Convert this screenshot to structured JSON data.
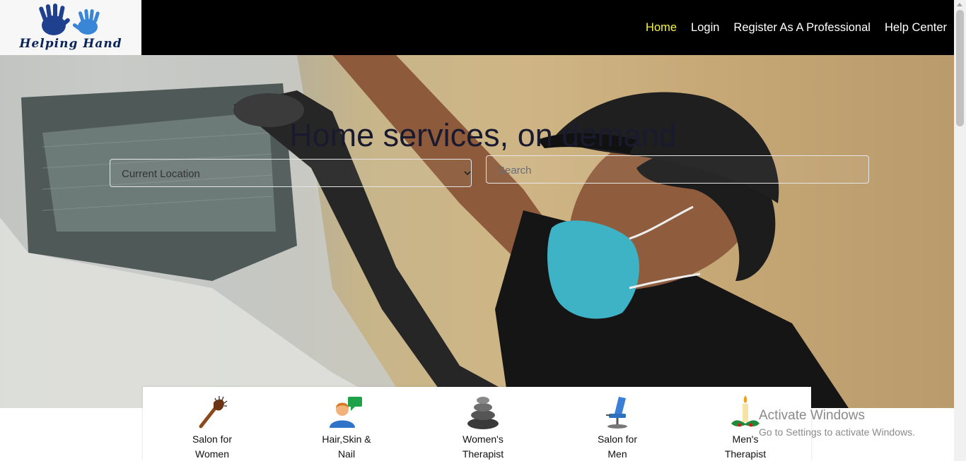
{
  "brand": {
    "name": "Helping Hand"
  },
  "nav": {
    "items": [
      {
        "label": "Home",
        "active": true
      },
      {
        "label": "Login"
      },
      {
        "label": "Register As A Professional"
      },
      {
        "label": "Help Center"
      }
    ]
  },
  "hero": {
    "title": "Home services, on demand",
    "location_select": {
      "selected": "Current Location"
    },
    "search": {
      "placeholder": "Search"
    }
  },
  "categories": [
    {
      "line1": "Salon for",
      "line2": "Women",
      "icon": "comb-icon"
    },
    {
      "line1": "Hair,Skin &",
      "line2": "Nail",
      "icon": "person-chat-icon"
    },
    {
      "line1": "Women's",
      "line2": "Therapist",
      "icon": "stones-icon"
    },
    {
      "line1": "Salon for",
      "line2": "Men",
      "icon": "barber-chair-icon"
    },
    {
      "line1": "Men's",
      "line2": "Therapist",
      "icon": "candle-icon"
    }
  ],
  "watermark": {
    "title": "Activate Windows",
    "subtitle": "Go to Settings to activate Windows."
  },
  "colors": {
    "nav_bg": "#000000",
    "active_link": "#f5f44a",
    "logo_blue": "#1f4fa8"
  }
}
